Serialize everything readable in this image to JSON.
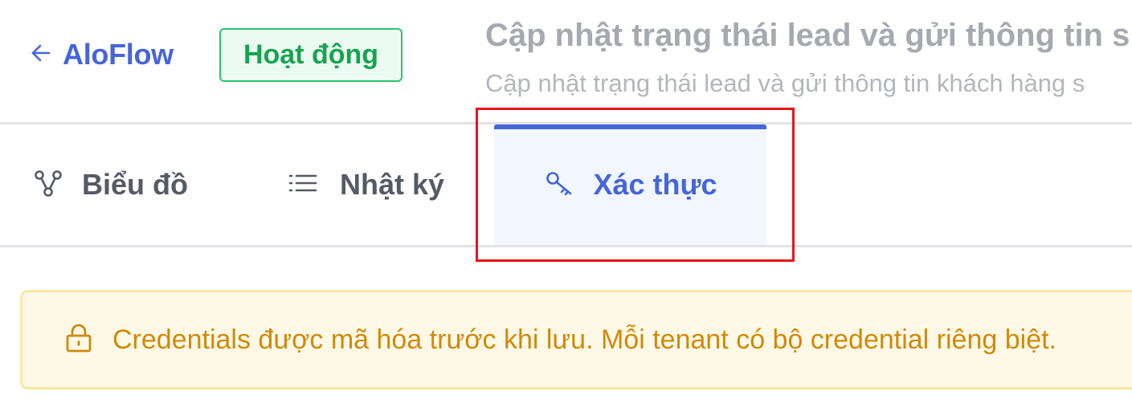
{
  "header": {
    "back_icon": "arrow-left-icon",
    "back_label": "AloFlow",
    "status_badge": "Hoạt động",
    "title": "Cập nhật trạng thái lead và gửi thông tin s",
    "subtitle": "Cập nhật trạng thái lead và gửi thông tin khách hàng s"
  },
  "tabs": [
    {
      "label": "Biểu đồ",
      "icon": "flow-diagram-icon",
      "active": false
    },
    {
      "label": "Nhật ký",
      "icon": "list-icon",
      "active": false
    },
    {
      "label": "Xác thực",
      "icon": "key-icon",
      "active": true
    }
  ],
  "notice": {
    "icon": "lock-icon",
    "text": "Credentials được mã hóa trước khi lưu. Mỗi tenant có bộ credential riêng biệt."
  },
  "colors": {
    "accent": "#4565db",
    "success": "#17a452",
    "warning_text": "#cf8a0a",
    "warning_bg": "#fef9e6",
    "highlight": "#e8141b"
  }
}
